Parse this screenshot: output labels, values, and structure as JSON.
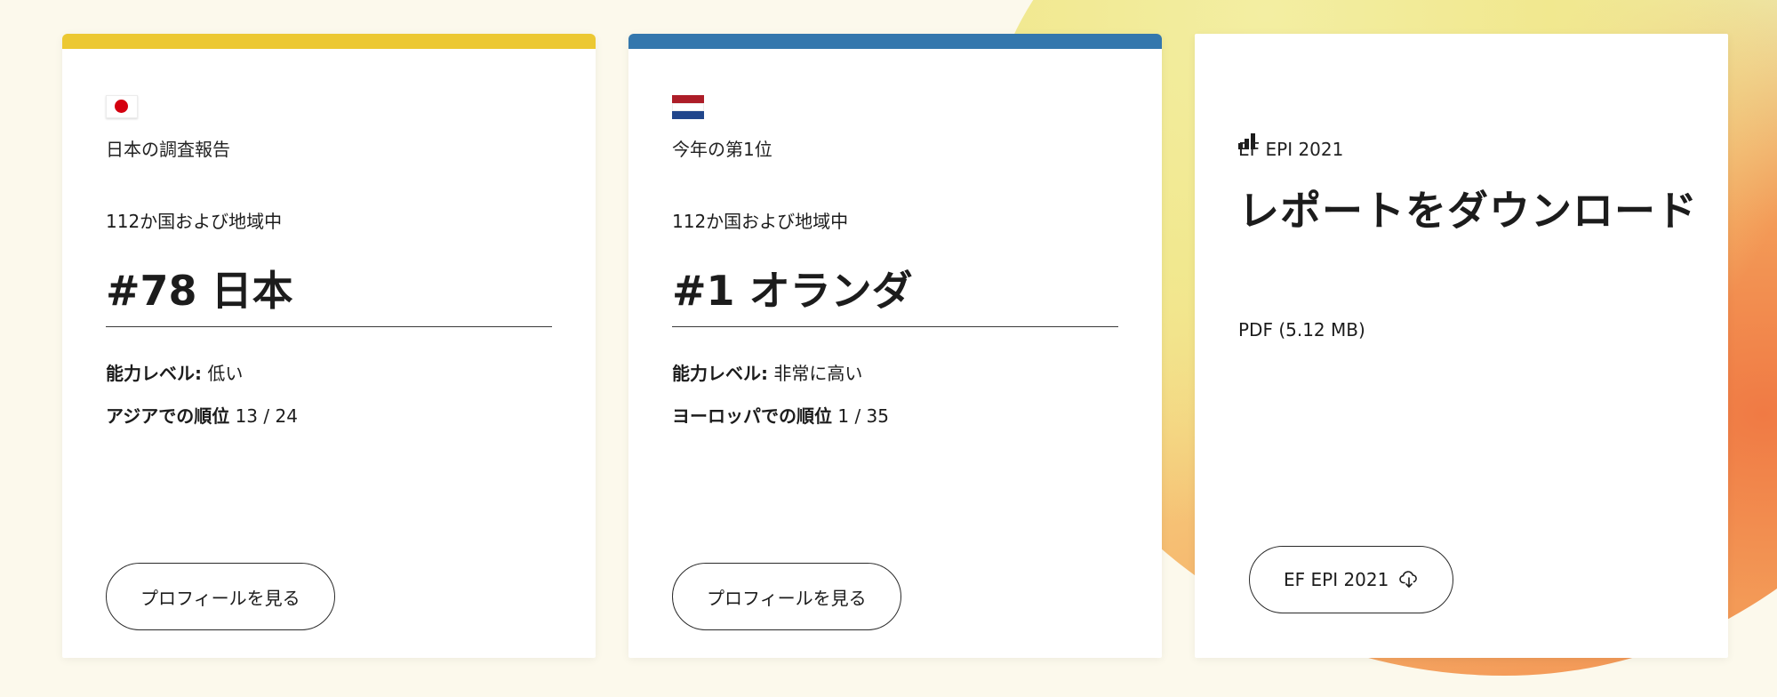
{
  "cards": [
    {
      "flag": "japan-flag-icon",
      "eyebrow": "日本の調査報告",
      "subtitle": "112か国および地域中",
      "rank": "#78 日本",
      "level_label": "能力レベル:",
      "level_value": "低い",
      "region_label": "アジアでの順位",
      "region_value": "13 / 24",
      "button_label": "プロフィールを見る",
      "accent_color": "#ecc832"
    },
    {
      "flag": "netherlands-flag-icon",
      "eyebrow": "今年の第1位",
      "subtitle": "112か国および地域中",
      "rank": "#1 オランダ",
      "level_label": "能力レベル:",
      "level_value": "非常に高い",
      "region_label": "ヨーロッパでの順位",
      "region_value": "1 / 35",
      "button_label": "プロフィールを見る",
      "accent_color": "#3477ad"
    },
    {
      "icon": "bar-chart-icon",
      "eyebrow": "EF EPI 2021",
      "title": "レポートをダウンロード",
      "file_info": "PDF (5.12 MB)",
      "button_label": "EF EPI 2021",
      "button_icon": "cloud-download-icon"
    }
  ],
  "colors": {
    "background": "#fcf9ec",
    "blob_yellow": "#f1e88f",
    "blob_orange": "#f07a44"
  }
}
